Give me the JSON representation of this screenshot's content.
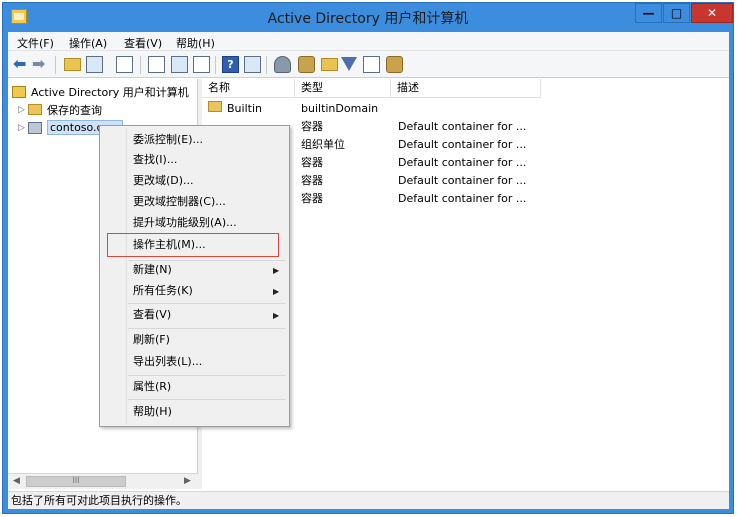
{
  "window": {
    "title": "Active Directory 用户和计算机",
    "buttons": {
      "min": "—",
      "max": "□",
      "close": "✕"
    }
  },
  "menubar": [
    "文件(F)",
    "操作(A)",
    "查看(V)",
    "帮助(H)"
  ],
  "toolbar": {
    "icons": [
      "back-arrow-icon",
      "forward-arrow-icon",
      "folder-up-icon",
      "show-hide-tree-icon",
      "clipboard-icon",
      "properties-icon",
      "refresh-icon",
      "export-list-icon",
      "help-icon",
      "mmc-icon",
      "new-user-icon",
      "new-group-icon",
      "new-ou-icon",
      "filter-icon",
      "find-icon",
      "add-to-group-icon"
    ],
    "help_glyph": "?"
  },
  "tree": {
    "root": "Active Directory 用户和计算机",
    "saved_queries": "保存的查询",
    "domain": "contoso.com"
  },
  "list": {
    "columns": [
      "名称",
      "类型",
      "描述"
    ],
    "rows": [
      {
        "name": "Builtin",
        "type": "builtinDomain",
        "desc": ""
      },
      {
        "name": "",
        "type": "容器",
        "desc": "Default container for ..."
      },
      {
        "name": "",
        "type": "组织单位",
        "desc": "Default container for ..."
      },
      {
        "name": "",
        "type": "容器",
        "desc": "Default container for ..."
      },
      {
        "name": "",
        "type": "容器",
        "desc": "Default container for ..."
      },
      {
        "name": "",
        "type": "容器",
        "desc": "Default container for ..."
      }
    ]
  },
  "context_menu": {
    "items": [
      {
        "label": "委派控制(E)...",
        "submenu": false
      },
      {
        "label": "查找(I)...",
        "submenu": false
      },
      {
        "label": "更改域(D)...",
        "submenu": false
      },
      {
        "label": "更改域控制器(C)...",
        "submenu": false
      },
      {
        "label": "提升域功能级别(A)...",
        "submenu": false
      },
      {
        "label": "操作主机(M)...",
        "submenu": false,
        "highlighted": true
      },
      {
        "label": "新建(N)",
        "submenu": true
      },
      {
        "label": "所有任务(K)",
        "submenu": true
      },
      {
        "label": "查看(V)",
        "submenu": true
      },
      {
        "label": "刷新(F)",
        "submenu": false
      },
      {
        "label": "导出列表(L)...",
        "submenu": false
      },
      {
        "label": "属性(R)",
        "submenu": false
      },
      {
        "label": "帮助(H)",
        "submenu": false
      }
    ],
    "submenu_glyph": "▶",
    "highlight_color": "#d9473f"
  },
  "scrollbar": {
    "left_glyph": "◀",
    "right_glyph": "▶",
    "thumb_glyph": "III"
  },
  "status": "包括了所有可对此项目执行的操作。",
  "colors": {
    "title_bar": "#3c8dde",
    "close_button": "#c7372f"
  }
}
